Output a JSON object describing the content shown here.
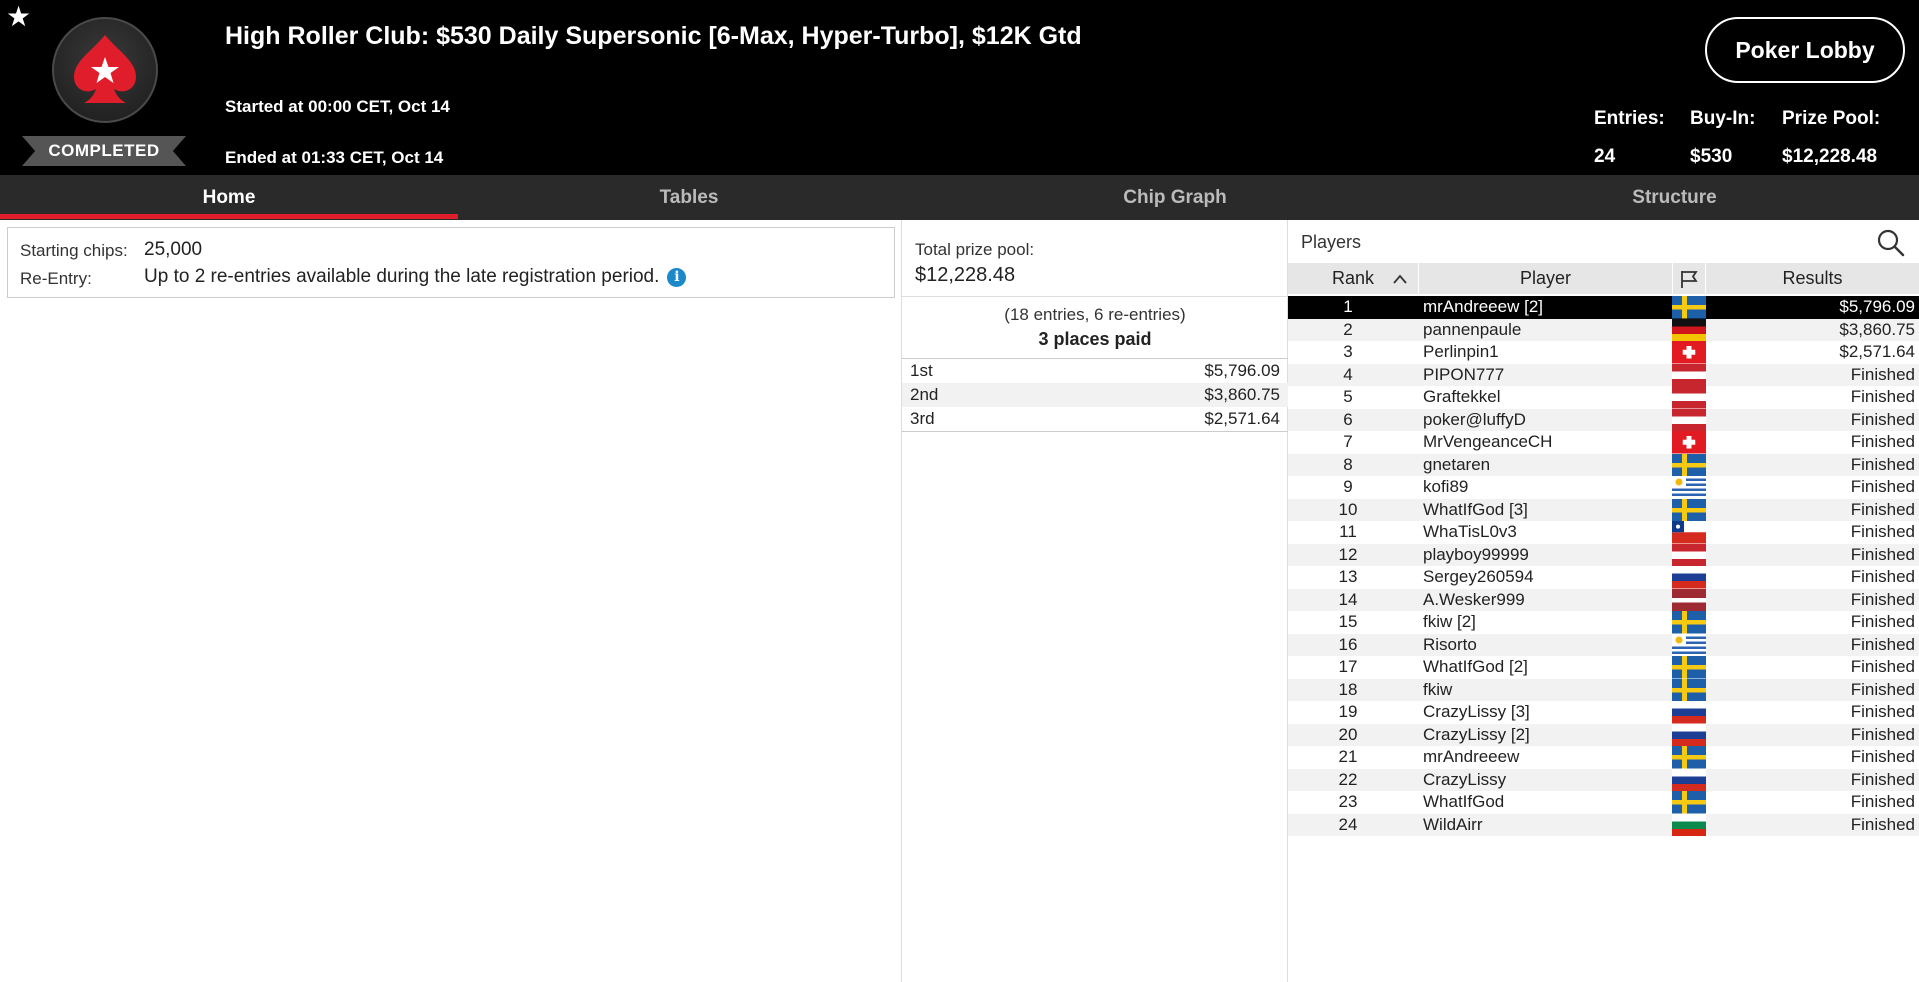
{
  "header": {
    "title": "High Roller Club: $530 Daily Supersonic [6-Max, Hyper-Turbo], $12K Gtd",
    "started": "Started at 00:00 CET, Oct 14",
    "ended": "Ended at 01:33 CET, Oct 14",
    "status": "COMPLETED",
    "lobby_button": "Poker Lobby",
    "stats": {
      "entries_label": "Entries:",
      "entries_value": "24",
      "buyin_label": "Buy-In:",
      "buyin_value": "$530",
      "prizepool_label": "Prize Pool:",
      "prizepool_value": "$12,228.48"
    }
  },
  "tabs": [
    {
      "label": "Home",
      "active": true
    },
    {
      "label": "Tables",
      "active": false
    },
    {
      "label": "Chip Graph",
      "active": false
    },
    {
      "label": "Structure",
      "active": false
    }
  ],
  "info": {
    "starting_chips_label": "Starting chips:",
    "starting_chips_value": "25,000",
    "reentry_label": "Re-Entry:",
    "reentry_value": "Up to 2 re-entries available during the late registration period."
  },
  "prizes": {
    "label": "Total prize pool:",
    "value": "$12,228.48",
    "entries_note": "(18 entries, 6 re-entries)",
    "places_paid": "3 places paid",
    "payouts": [
      {
        "place": "1st",
        "amount": "$5,796.09"
      },
      {
        "place": "2nd",
        "amount": "$3,860.75"
      },
      {
        "place": "3rd",
        "amount": "$2,571.64"
      }
    ]
  },
  "players": {
    "title": "Players",
    "columns": {
      "rank": "Rank",
      "player": "Player",
      "results": "Results"
    },
    "rows": [
      {
        "rank": "1",
        "name": "mrAndreeew [2]",
        "flag": "se",
        "result": "$5,796.09"
      },
      {
        "rank": "2",
        "name": "pannenpaule",
        "flag": "de",
        "result": "$3,860.75"
      },
      {
        "rank": "3",
        "name": "Perlinpin1",
        "flag": "ch",
        "result": "$2,571.64"
      },
      {
        "rank": "4",
        "name": "PIPON777",
        "flag": "at",
        "result": "Finished"
      },
      {
        "rank": "5",
        "name": "Graftekkel",
        "flag": "at",
        "result": "Finished"
      },
      {
        "rank": "6",
        "name": "poker@luffyD",
        "flag": "at",
        "result": "Finished"
      },
      {
        "rank": "7",
        "name": "MrVengeanceCH",
        "flag": "ch",
        "result": "Finished"
      },
      {
        "rank": "8",
        "name": "gnetaren",
        "flag": "se",
        "result": "Finished"
      },
      {
        "rank": "9",
        "name": "kofi89",
        "flag": "uy",
        "result": "Finished"
      },
      {
        "rank": "10",
        "name": "WhatIfGod [3]",
        "flag": "se",
        "result": "Finished"
      },
      {
        "rank": "11",
        "name": "WhaTisL0v3",
        "flag": "cl",
        "result": "Finished"
      },
      {
        "rank": "12",
        "name": "playboy99999",
        "flag": "at",
        "result": "Finished"
      },
      {
        "rank": "13",
        "name": "Sergey260594",
        "flag": "ru",
        "result": "Finished"
      },
      {
        "rank": "14",
        "name": "A.Wesker999",
        "flag": "lv",
        "result": "Finished"
      },
      {
        "rank": "15",
        "name": "fkiw [2]",
        "flag": "se",
        "result": "Finished"
      },
      {
        "rank": "16",
        "name": "Risorto",
        "flag": "uy",
        "result": "Finished"
      },
      {
        "rank": "17",
        "name": "WhatIfGod [2]",
        "flag": "se",
        "result": "Finished"
      },
      {
        "rank": "18",
        "name": "fkiw",
        "flag": "se",
        "result": "Finished"
      },
      {
        "rank": "19",
        "name": "CrazyLissy [3]",
        "flag": "ru",
        "result": "Finished"
      },
      {
        "rank": "20",
        "name": "CrazyLissy [2]",
        "flag": "ru",
        "result": "Finished"
      },
      {
        "rank": "21",
        "name": "mrAndreeew",
        "flag": "se",
        "result": "Finished"
      },
      {
        "rank": "22",
        "name": "CrazyLissy",
        "flag": "ru",
        "result": "Finished"
      },
      {
        "rank": "23",
        "name": "WhatIfGod",
        "flag": "se",
        "result": "Finished"
      },
      {
        "rank": "24",
        "name": "WildAirr",
        "flag": "bg",
        "result": "Finished"
      }
    ]
  },
  "colors": {
    "accent": "#e01e2b",
    "header_bg": "#000000",
    "tabbar_bg": "#2a2a2a",
    "info_icon": "#1a88c9"
  }
}
